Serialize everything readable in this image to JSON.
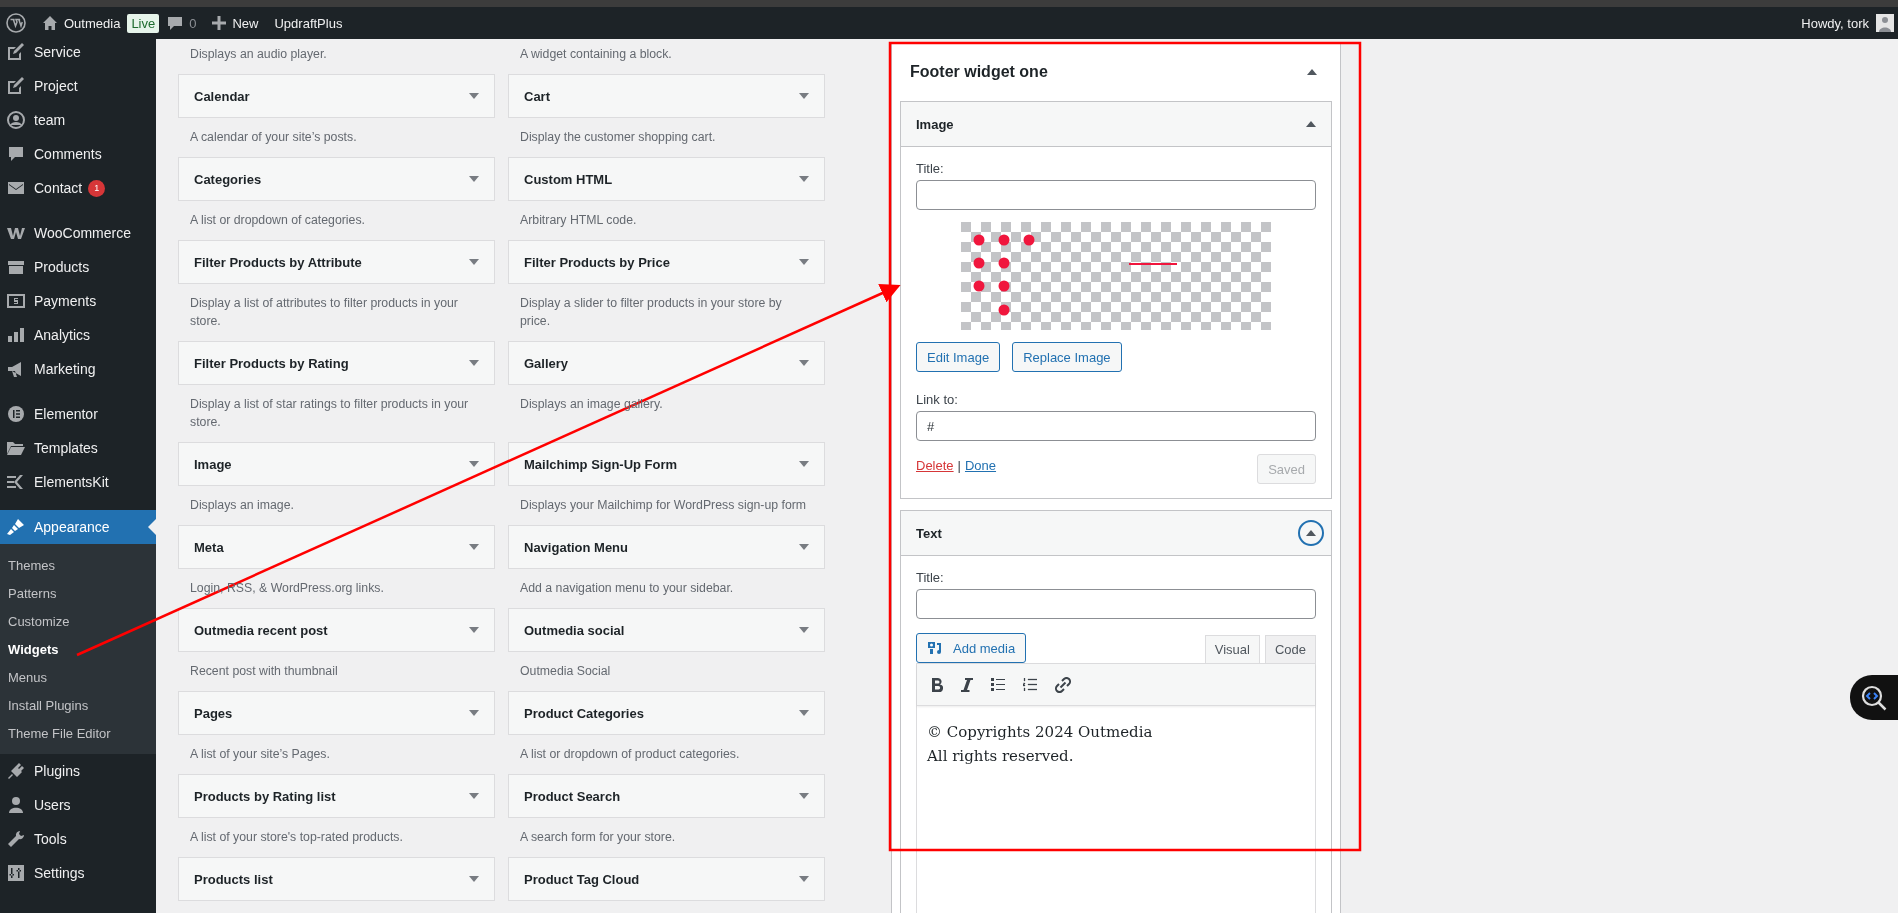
{
  "admin_bar": {
    "site_name": "Outmedia",
    "live_badge": "Live",
    "comments_count": "0",
    "new_label": "New",
    "plugin_link": "UpdraftPlus",
    "greeting": "Howdy, tork"
  },
  "sidebar": {
    "groups": [
      [
        {
          "label": "Service",
          "selected": false
        },
        {
          "label": "Project",
          "selected": false
        },
        {
          "label": "team",
          "selected": false
        },
        {
          "label": "Comments",
          "selected": false
        },
        {
          "label": "Contact",
          "selected": false,
          "badge": "1"
        }
      ],
      [
        {
          "label": "WooCommerce",
          "selected": false
        },
        {
          "label": "Products",
          "selected": false
        },
        {
          "label": "Payments",
          "selected": false
        },
        {
          "label": "Analytics",
          "selected": false
        },
        {
          "label": "Marketing",
          "selected": false
        }
      ],
      [
        {
          "label": "Elementor",
          "selected": false
        },
        {
          "label": "Templates",
          "selected": false
        },
        {
          "label": "ElementsKit",
          "selected": false
        }
      ],
      [
        {
          "label": "Appearance",
          "selected": true,
          "children": [
            {
              "label": "Themes",
              "selected": false
            },
            {
              "label": "Patterns",
              "selected": false
            },
            {
              "label": "Customize",
              "selected": false
            },
            {
              "label": "Widgets",
              "selected": true
            },
            {
              "label": "Menus",
              "selected": false
            },
            {
              "label": "Install Plugins",
              "selected": false
            },
            {
              "label": "Theme File Editor",
              "selected": false
            }
          ]
        },
        {
          "label": "Plugins",
          "selected": false
        },
        {
          "label": "Users",
          "selected": false
        },
        {
          "label": "Tools",
          "selected": false
        },
        {
          "label": "Settings",
          "selected": false
        }
      ]
    ]
  },
  "widgets": [
    {
      "description": "Displays an audio player."
    },
    {
      "description": "A widget containing a block."
    },
    {
      "name": "Calendar",
      "description": "A calendar of your site’s posts."
    },
    {
      "name": "Cart",
      "description": "Display the customer shopping cart."
    },
    {
      "name": "Categories",
      "description": "A list or dropdown of categories."
    },
    {
      "name": "Custom HTML",
      "description": "Arbitrary HTML code."
    },
    {
      "name": "Filter Products by Attribute",
      "description": "Display a list of attributes to filter products in your store."
    },
    {
      "name": "Filter Products by Price",
      "description": "Display a slider to filter products in your store by price."
    },
    {
      "name": "Filter Products by Rating",
      "description": "Display a list of star ratings to filter products in your store."
    },
    {
      "name": "Gallery",
      "description": "Displays an image gallery."
    },
    {
      "name": "Image",
      "description": "Displays an image."
    },
    {
      "name": "Mailchimp Sign-Up Form",
      "description": "Displays your Mailchimp for WordPress sign-up form"
    },
    {
      "name": "Meta",
      "description": "Login, RSS, & WordPress.org links."
    },
    {
      "name": "Navigation Menu",
      "description": "Add a navigation menu to your sidebar."
    },
    {
      "name": "Outmedia recent post",
      "description": "Recent post with thumbnail"
    },
    {
      "name": "Outmedia social",
      "description": "Outmedia Social"
    },
    {
      "name": "Pages",
      "description": "A list of your site’s Pages."
    },
    {
      "name": "Product Categories",
      "description": "A list or dropdown of product categories."
    },
    {
      "name": "Products by Rating list",
      "description": "A list of your store's top-rated products."
    },
    {
      "name": "Product Search",
      "description": "A search form for your store."
    },
    {
      "name": "Products list"
    },
    {
      "name": "Product Tag Cloud"
    }
  ],
  "widget_area": {
    "title": "Footer widget one",
    "expanded": true,
    "widgets": [
      {
        "kind": "image",
        "title": "Image",
        "expanded": true,
        "focused": false,
        "title_label": "Title:",
        "buttons": [
          "Edit Image",
          "Replace Image"
        ],
        "link_label": "Link to:",
        "link_value": "#",
        "delete_link": "Delete",
        "separator": "|",
        "done_link": "Done",
        "save_button": {
          "label": "Saved",
          "disabled": true
        }
      },
      {
        "kind": "text",
        "title": "Text",
        "expanded": true,
        "focused": true,
        "title_label": "Title:",
        "add_media": "Add media",
        "tabs": [
          {
            "label": "Visual",
            "selected": true
          },
          {
            "label": "Code",
            "selected": false
          }
        ],
        "content_lines": [
          "© Copyrights 2024 Outmedia",
          "All rights reserved."
        ]
      }
    ]
  },
  "annotations": {
    "arrow": true,
    "frame": true
  }
}
